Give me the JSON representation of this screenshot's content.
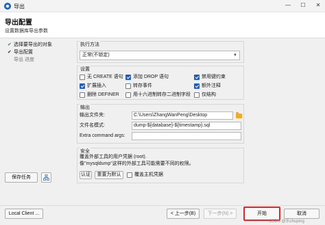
{
  "window": {
    "title": "导出",
    "minimize": "—",
    "maximize": "☐",
    "close": "✕"
  },
  "header": {
    "title": "导出配置",
    "subtitle": "设置数据库导出参数"
  },
  "steps": [
    {
      "label": "选择要导出的对象",
      "mark": "✔"
    },
    {
      "label": "导出配置",
      "mark": "✔"
    },
    {
      "label": "导出 进度",
      "mark": ""
    }
  ],
  "left_buttons": {
    "save_task": "保存任务",
    "local_client": "Local Client ..."
  },
  "method": {
    "title": "执行方法",
    "selected": "正常(不锁定)"
  },
  "settings": {
    "title": "设置",
    "options": [
      {
        "label": "无 CREATE 语句",
        "checked": false
      },
      {
        "label": "添加 DROP 语句",
        "checked": true
      },
      {
        "label": "禁用键约束",
        "checked": true
      },
      {
        "label": "扩展插入",
        "checked": true
      },
      {
        "label": "转存事件",
        "checked": false
      },
      {
        "label": "额外注释",
        "checked": true
      },
      {
        "label": "删除 DEFINER",
        "checked": false
      },
      {
        "label": "用十六进制转存二进制字段",
        "checked": false
      },
      {
        "label": "仅结构",
        "checked": false
      }
    ]
  },
  "output": {
    "title": "输出",
    "folder_label": "输出文件夹:",
    "folder_value": "C:\\Users\\ZhangWanPeng\\Desktop",
    "filename_label": "文件名模式:",
    "filename_value": "dump-${database}-${timestamp}.sql",
    "extra_label": "Extra command args:",
    "extra_value": ""
  },
  "security": {
    "title": "安全",
    "line1": "覆盖外部工具的用户凭据 (root).",
    "line2": "像\"mysqldump\"这样的外部工具可能需要不同的权限。",
    "auth_button": "认证",
    "reset_button": "重置为默认",
    "override_label": "覆盖主机凭据",
    "override_checked": false
  },
  "footer": {
    "prev": "< 上一步(B)",
    "next": "下一步(N) >",
    "start": "开始",
    "cancel": "取消"
  },
  "watermark": "CSDN @乐zhuping"
}
